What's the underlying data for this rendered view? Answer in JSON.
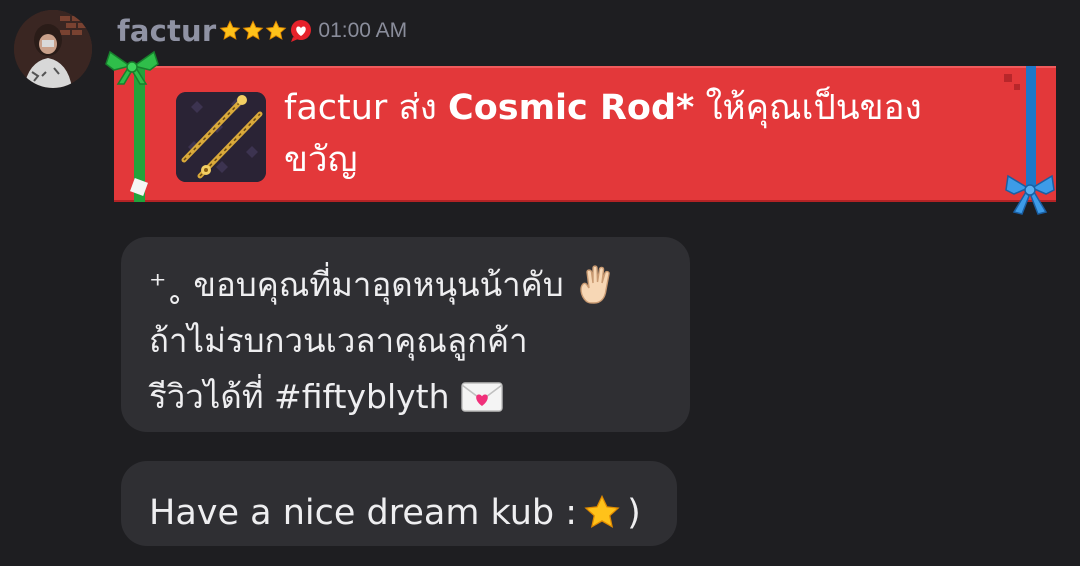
{
  "message": {
    "username": "factur",
    "timestamp": "01:00 AM",
    "badges": [
      "star-badge",
      "star-badge",
      "star-badge",
      "heart-badge"
    ],
    "avatar": "user-avatar"
  },
  "gift": {
    "sender": "factur",
    "verb_before": " ส่ง ",
    "item_name": "Cosmic Rod*",
    "verb_after": " ให้คุณเป็นของขวัญ",
    "thumbnail_icon": "cosmic-rod-icon",
    "colors": {
      "card": "#e3383a",
      "ribbon_left": "#22a33b",
      "ribbon_right": "#1d78c9"
    }
  },
  "bubbles": [
    {
      "lines": [
        {
          "text": "⁺˳ ขอบคุณที่มาอุดหนุนน้าคับ",
          "emoji": "raised-hand-emoji"
        },
        {
          "text": "ถ้าไม่รบกวนเวลาคุณลูกค้า"
        },
        {
          "text": "รีวิวได้ที่ #fiftyblyth",
          "emoji": "love-letter-emoji"
        }
      ]
    },
    {
      "text_before": "Have a nice dream kub :",
      "emoji": "star-emoji",
      "text_after": ")"
    }
  ]
}
